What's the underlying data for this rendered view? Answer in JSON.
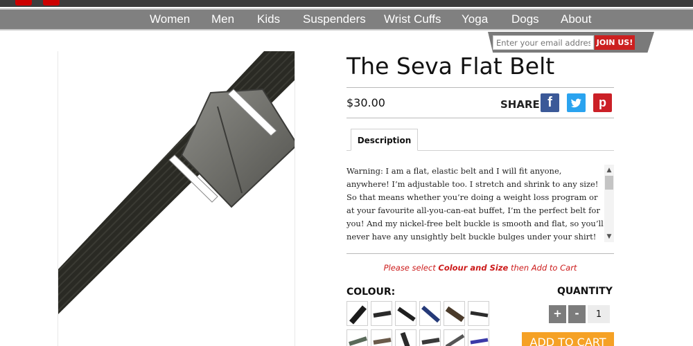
{
  "nav": {
    "items": [
      "Women",
      "Men",
      "Kids",
      "Suspenders",
      "Wrist Cuffs",
      "Yoga",
      "Dogs",
      "About"
    ]
  },
  "newsletter": {
    "placeholder": "Enter your email address..",
    "button": "JOIN US!"
  },
  "product": {
    "title": "The Seva Flat Belt",
    "price": "$30.00",
    "share_label": "SHARE",
    "social": [
      "f",
      "t",
      "p"
    ],
    "tabs": [
      "Description"
    ],
    "description": "Warning: I am a flat, elastic belt and I will fit anyone, anywhere! I’m adjustable too. I stretch and shrink to any size! So that means whether you’re doing a weight loss program or at your favourite all-you-can-eat buffet, I’m the perfect belt for you! And my nickel-free belt buckle is smooth and flat, so you’ll never have any unsightly belt buckle bulges under your shirt! Better yet, move the belt buckle to the side so that",
    "notice": {
      "prefix": "Please select ",
      "bold": "Colour and Size",
      "suffix": " then Add to Cart"
    },
    "colour_label": "COLOUR:",
    "quantity_label": "QUANTITY",
    "quantity_value": "1",
    "plus": "+",
    "minus": "-",
    "add_to_cart": "ADD TO CART"
  },
  "colors": {
    "nav_bg": "#808080",
    "accent_red": "#cc1f1f",
    "cart_orange": "#f5a125",
    "facebook": "#3b5998",
    "twitter": "#2aa3ef",
    "pinterest": "#cb2027"
  }
}
